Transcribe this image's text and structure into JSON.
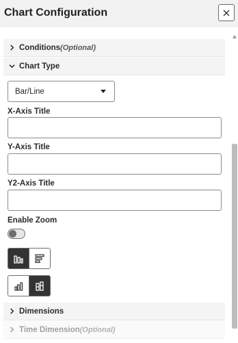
{
  "window": {
    "title": "Chart Configuration",
    "close_icon": "close-icon"
  },
  "sections": {
    "conditions": {
      "label": "Conditions",
      "optional": "(Optional)",
      "state": "collapsed"
    },
    "chart_type": {
      "label": "Chart Type",
      "state": "expanded"
    },
    "dimensions": {
      "label": "Dimensions",
      "state": "collapsed"
    },
    "time_dimension": {
      "label": "Time Dimension",
      "optional": "(Optional)",
      "state": "collapsed"
    }
  },
  "chart_type_select": {
    "value": "Bar/Line"
  },
  "fields": {
    "x_axis_title": {
      "label": "X-Axis Title",
      "value": ""
    },
    "y_axis_title": {
      "label": "Y-Axis Title",
      "value": ""
    },
    "y2_axis_title": {
      "label": "Y2-Axis Title",
      "value": ""
    }
  },
  "enable_zoom": {
    "label": "Enable Zoom",
    "on": false
  },
  "orientation_options": {
    "selected": "vertical",
    "items": [
      {
        "id": "vertical",
        "icon": "vertical-bars-icon"
      },
      {
        "id": "horizontal",
        "icon": "horizontal-bars-icon"
      }
    ]
  },
  "layout_options": {
    "selected": "stacked",
    "items": [
      {
        "id": "grouped",
        "icon": "grouped-bars-icon"
      },
      {
        "id": "stacked",
        "icon": "stacked-bars-icon"
      }
    ]
  },
  "colors": {
    "accent_dark": "#333333",
    "section_bg": "#f4f4f4",
    "header_bg": "#f2f2f2"
  }
}
